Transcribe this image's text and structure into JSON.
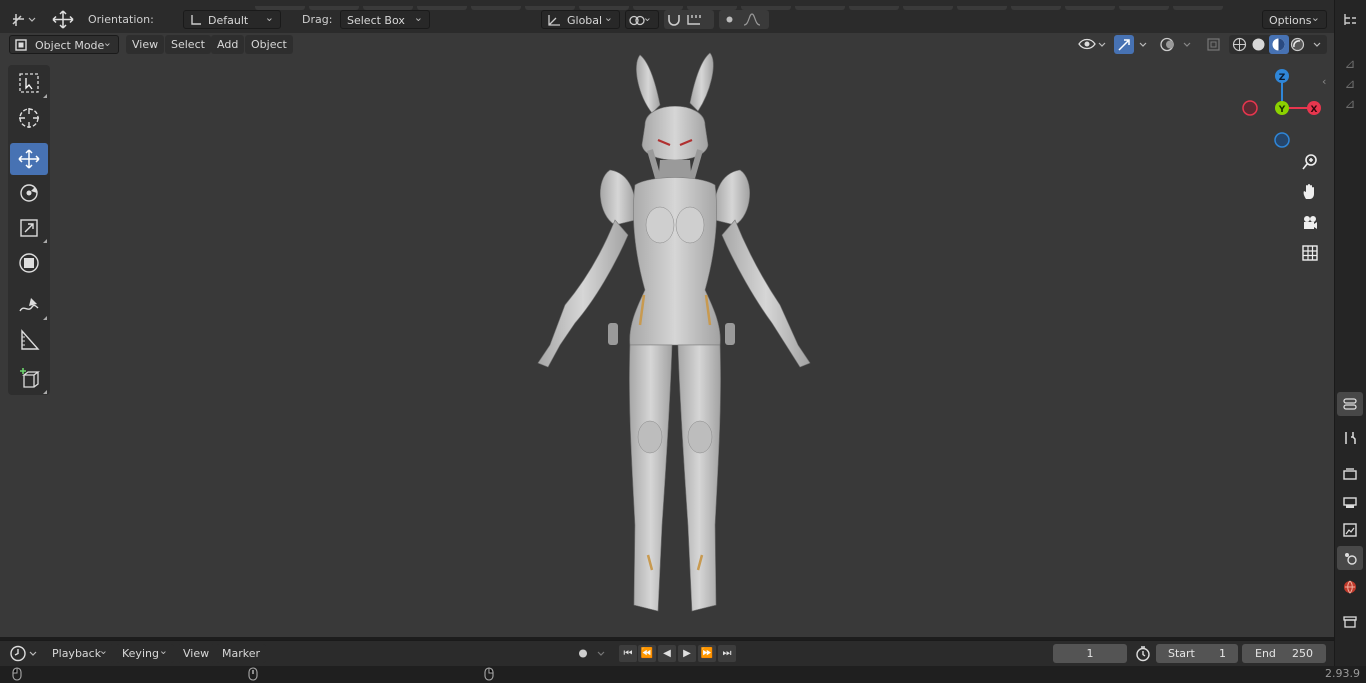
{
  "top_header": {
    "orientation_label": "Orientation:",
    "orientation_value": "Default",
    "drag_label": "Drag:",
    "drag_value": "Select Box",
    "transform_orientation": "Global",
    "options_label": "Options"
  },
  "viewport_header": {
    "mode": "Object Mode",
    "menus": [
      "View",
      "Select",
      "Add",
      "Object"
    ]
  },
  "gizmo": {
    "z": "Z",
    "y": "Y",
    "x": "X"
  },
  "timeline": {
    "menus": [
      "Playback",
      "Keying",
      "View",
      "Marker"
    ],
    "current_frame": "1",
    "start_label": "Start",
    "start_value": "1",
    "end_label": "End",
    "end_value": "250"
  },
  "status": {
    "version": "2.93.9"
  },
  "colors": {
    "accent": "#4772b3",
    "axis_x": "#e8364e",
    "axis_y": "#8bd200",
    "axis_z": "#2f86d8",
    "viewport": "#393939"
  },
  "icons": {
    "tools": [
      "select-box-icon",
      "cursor-icon",
      "move-icon",
      "rotate-icon",
      "scale-icon",
      "transform-icon",
      "annotate-icon",
      "measure-icon",
      "add-cube-icon"
    ],
    "nav": [
      "zoom-icon",
      "pan-hand-icon",
      "camera-icon",
      "grid-perspective-icon"
    ],
    "properties": [
      "tool-icon",
      "render-icon",
      "output-icon",
      "view-layer-icon",
      "scene-icon",
      "world-icon",
      "collection-icon"
    ]
  }
}
